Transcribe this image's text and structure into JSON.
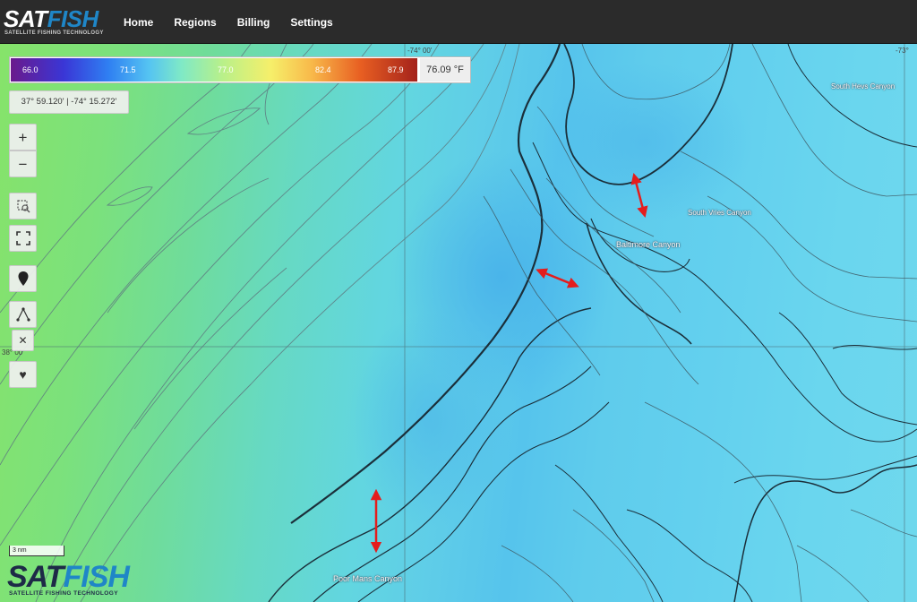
{
  "brand": {
    "logo_sat": "SAT",
    "logo_fish": "FISH",
    "tagline": "SATELLITE FISHING TECHNOLOGY",
    "accent_color": "#1f86c7"
  },
  "nav": {
    "items": [
      "Home",
      "Regions",
      "Billing",
      "Settings"
    ]
  },
  "color_scale": {
    "ticks": [
      "66.0",
      "71.5",
      "77.0",
      "82.4",
      "87.9"
    ],
    "current_value": "76.09 °F"
  },
  "coordinates": "37° 59.120' | -74° 15.272'",
  "controls": {
    "zoom_in": "+",
    "zoom_out": "−",
    "zoom_box_icon": "zoom-box-icon",
    "fullscreen_icon": "fullscreen-icon",
    "marker_icon": "map-pin-icon",
    "measure_icon": "measure-icon",
    "clear_icon": "close-icon",
    "favorite_icon": "heart-icon"
  },
  "graticule": {
    "top_lon": "-74° 00'",
    "left_lat": "38° 00'",
    "right_lon": "-73°"
  },
  "map_labels": {
    "south_vries": "South Vries Canyon",
    "south_hevs": "South Hevs Canyon",
    "baltimore": "Baltimore Canyon",
    "poor_mans": "Poor Mans Canyon"
  },
  "scale_bar": "3 nm"
}
